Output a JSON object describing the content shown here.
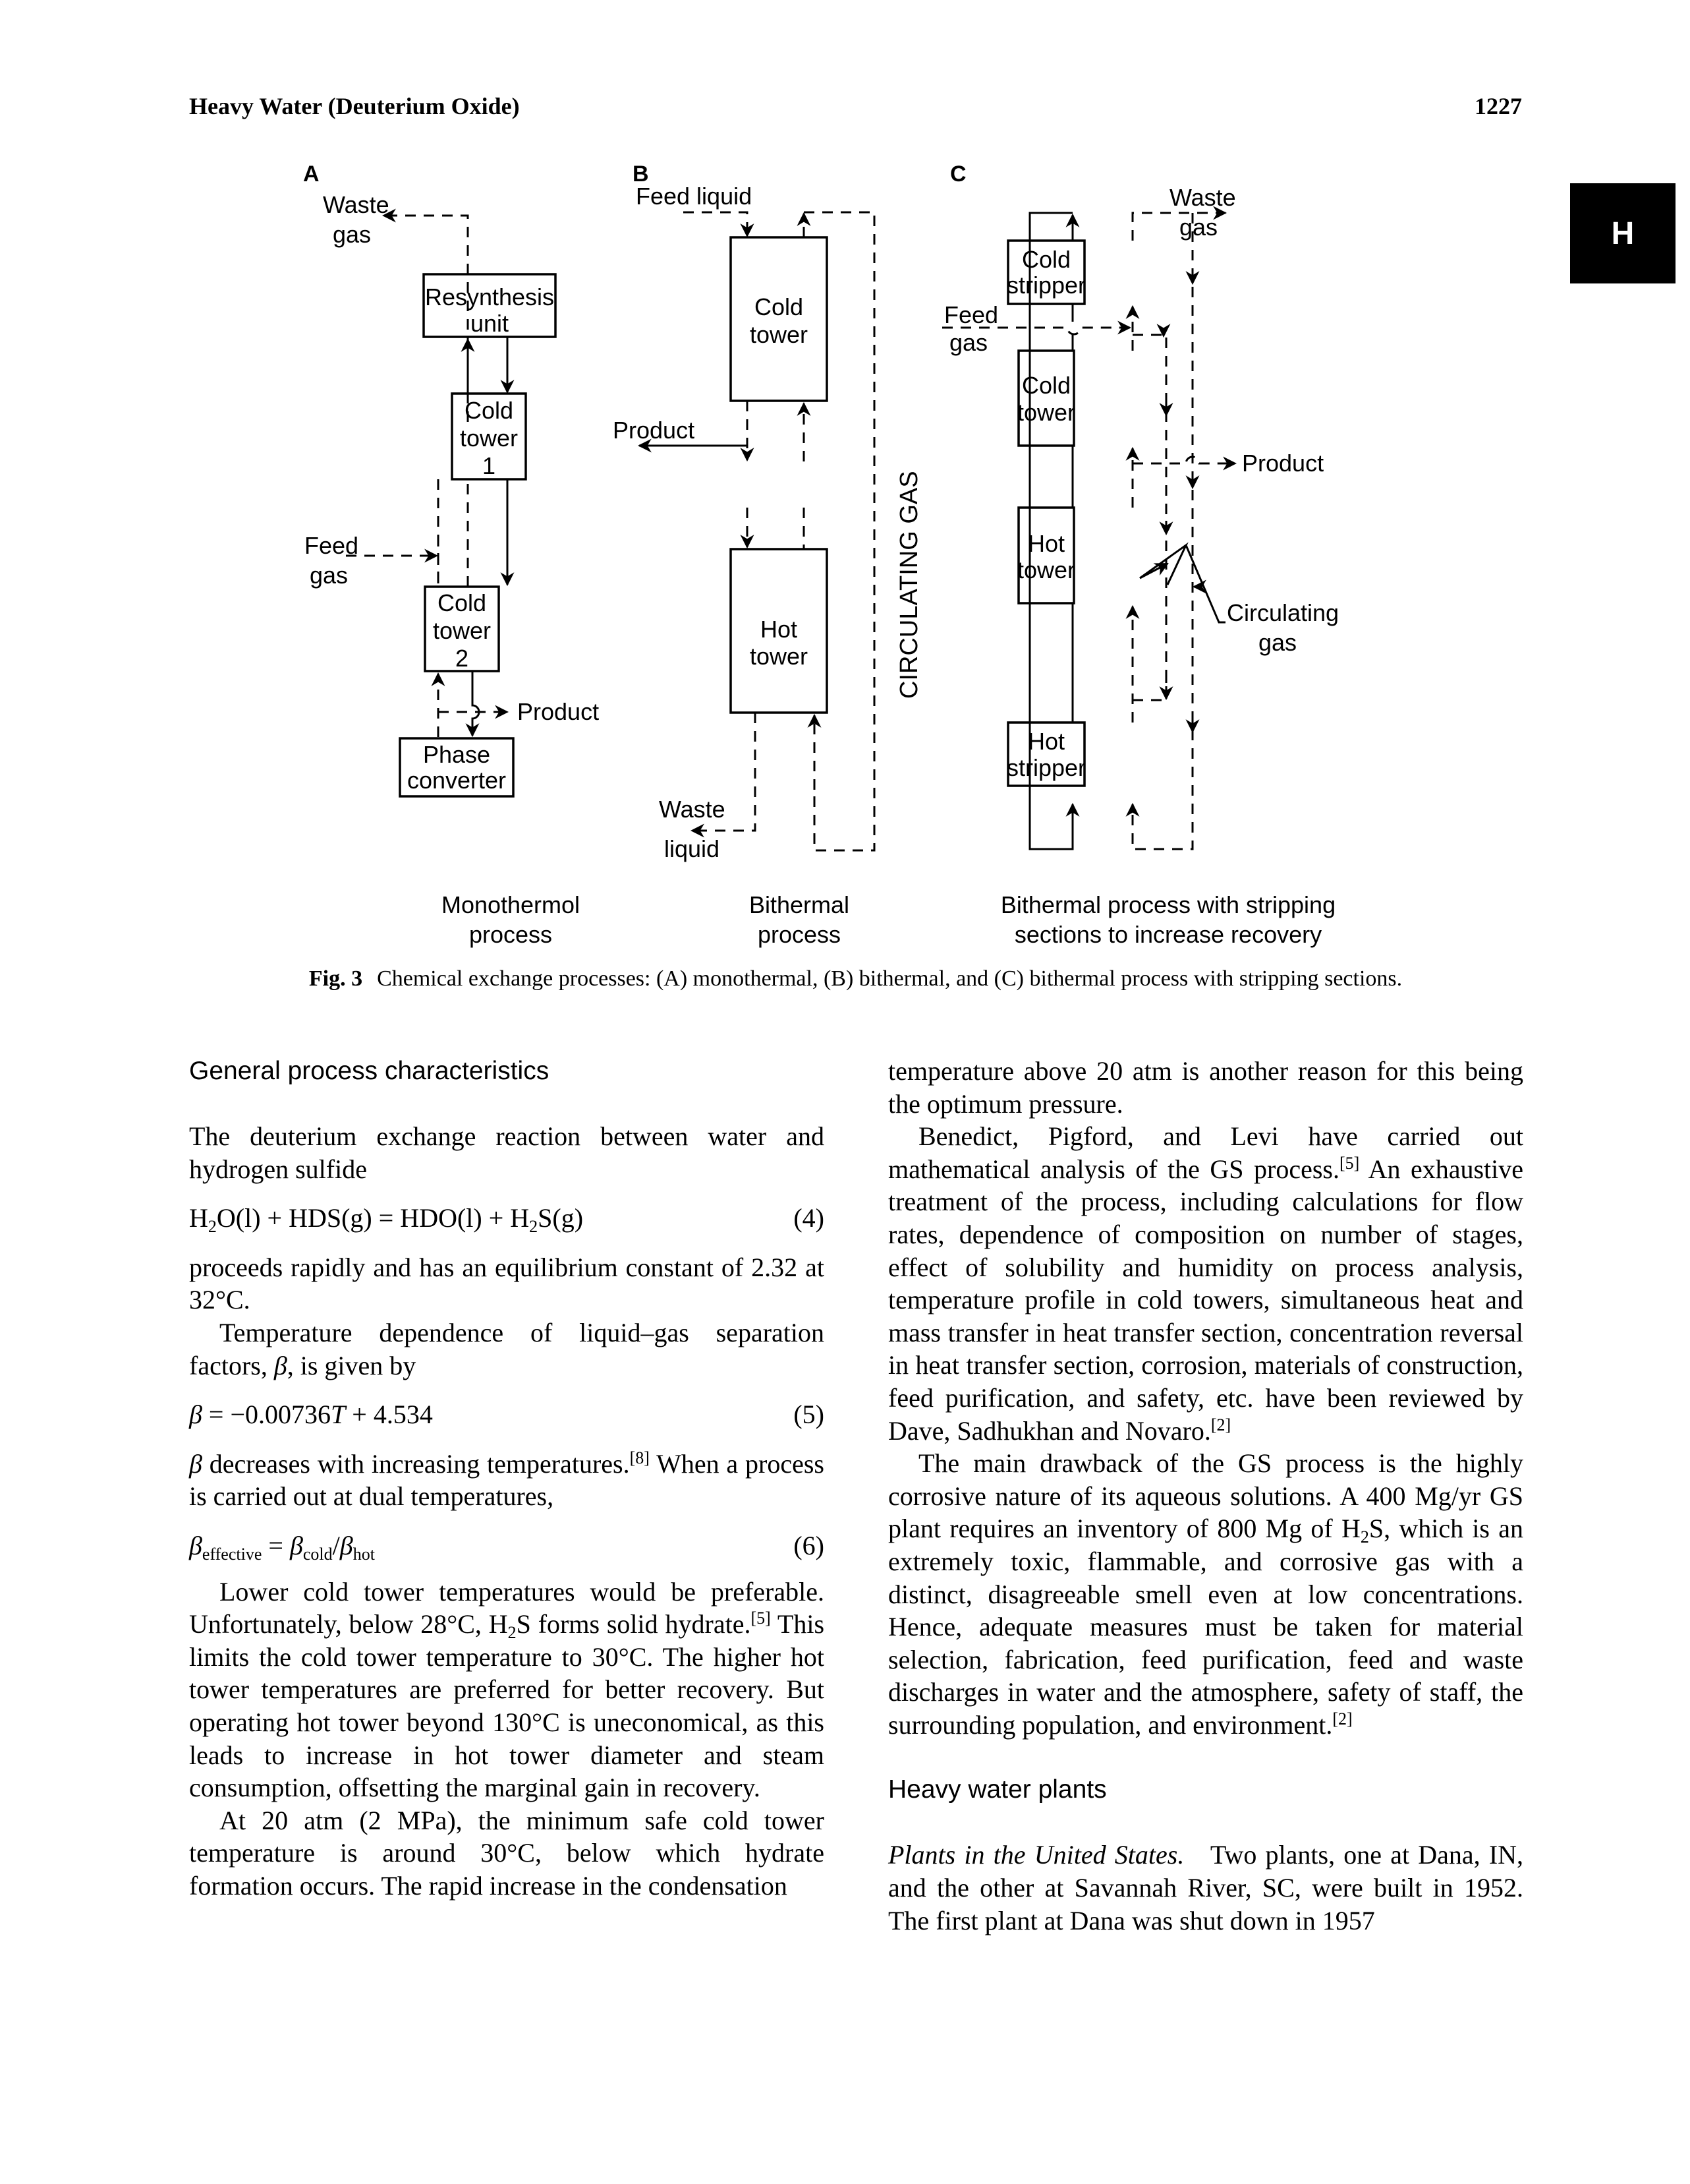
{
  "running_head": {
    "title": "Heavy Water (Deuterium Oxide)",
    "page_number": "1227"
  },
  "thumb_tab": {
    "letter": "H"
  },
  "figure": {
    "panel_a": {
      "letter": "A",
      "waste_gas": [
        "Waste",
        "gas"
      ],
      "feed_gas": [
        "Feed",
        "gas"
      ],
      "resynthesis_unit": [
        "Resynthesis",
        "unit"
      ],
      "cold_tower_1": [
        "Cold",
        "tower",
        "1"
      ],
      "cold_tower_2": [
        "Cold",
        "tower",
        "2"
      ],
      "product": "Product",
      "phase_converter": [
        "Phase",
        "converter"
      ],
      "subtitle": [
        "Monothermol",
        "process"
      ]
    },
    "panel_b": {
      "letter": "B",
      "feed_liquid": "Feed liquid",
      "cold_tower": [
        "Cold",
        "tower"
      ],
      "hot_tower": [
        "Hot",
        "tower"
      ],
      "product": "Product",
      "waste_liquid": [
        "Waste",
        "liquid"
      ],
      "circulating_gas": "CIRCULATING GAS",
      "subtitle": [
        "Bithermal",
        "process"
      ]
    },
    "panel_c": {
      "letter": "C",
      "waste_gas": [
        "Waste",
        "gas"
      ],
      "feed_gas": [
        "Feed",
        "gas"
      ],
      "cold_stripper": [
        "Cold",
        "stripper"
      ],
      "cold_tower": [
        "Cold",
        "tower"
      ],
      "hot_tower": [
        "Hot",
        "tower"
      ],
      "hot_stripper": [
        "Hot",
        "stripper"
      ],
      "product": "Product",
      "circulating_gas": [
        "Circulating",
        "gas"
      ],
      "subtitle": [
        "Bithermal process with stripping",
        "sections to increase recovery"
      ]
    },
    "caption_label": "Fig. 3",
    "caption_text": "Chemical exchange processes: (A) monothermal, (B) bithermal, and (C) bithermal process with stripping sections."
  },
  "left_column": {
    "heading": "General process characteristics",
    "p1": "The deuterium exchange reaction between water and hydrogen sulfide",
    "eq4": {
      "lhs_a": "H",
      "lhs_a_sub": "2",
      "lhs_b": "O(l) + HDS(g) = HDO(l) + H",
      "rhs_sub": "2",
      "rhs_b": "S(g)",
      "number": "(4)"
    },
    "p2": "proceeds rapidly and has an equilibrium constant of 2.32 at 32°C.",
    "p3_a": "Temperature dependence of liquid–gas separation factors, ",
    "p3_beta": "β",
    "p3_b": ", is given by",
    "eq5": {
      "beta": "β",
      "text_a": " = −0.00736",
      "T": "T",
      "text_b": " + 4.534",
      "number": "(5)"
    },
    "p4_beta": "β",
    "p4_a": " decreases with increasing temperatures.",
    "p4_ref": "[8]",
    "p4_b": " When a process is carried out at dual temperatures,",
    "eq6": {
      "beta": "β",
      "sub_eff": "effective",
      "eq": " = ",
      "sub_cold": "cold",
      "slash": "/",
      "sub_hot": "hot",
      "number": "(6)"
    },
    "p5_a": "Lower cold tower temperatures would be preferable. Unfortunately, below 28°C, H",
    "p5_sub": "2",
    "p5_b": "S forms solid hydrate.",
    "p5_ref": "[5]",
    "p5_c": " This limits the cold tower temperature to 30°C. The higher hot tower temperatures are preferred for better recovery. But operating hot tower beyond 130°C is uneconomical, as this leads to increase in hot tower diameter and steam consumption, offsetting the marginal gain in recovery.",
    "p6": "At 20 atm (2 MPa), the minimum safe cold tower temperature is around 30°C, below which hydrate formation occurs. The rapid increase in the condensation"
  },
  "right_column": {
    "p1": "temperature above 20 atm is another reason for this being the optimum pressure.",
    "p2_a": "Benedict, Pigford, and Levi have carried out mathematical analysis of the GS process.",
    "p2_ref1": "[5]",
    "p2_b": " An exhaustive treatment of the process, including calculations for flow rates, dependence of composition on number of stages, effect of solubility and humidity on process analysis, temperature profile in cold towers, simultaneous heat and mass transfer in heat transfer section, concentration reversal in heat transfer section, corrosion, materials of construction, feed purification, and safety, etc. have been reviewed by Dave, Sadhukhan and Novaro.",
    "p2_ref2": "[2]",
    "p3_a": "The main drawback of the GS process is the highly corrosive nature of its aqueous solutions. A 400 Mg/yr GS plant requires an inventory of 800 Mg of H",
    "p3_sub": "2",
    "p3_b": "S, which is an extremely toxic, flammable, and corrosive gas with a distinct, disagreeable smell even at low concentrations. Hence, adequate measures must be taken for material selection, fabrication, feed purification, feed and waste discharges in water and the atmosphere, safety of staff, the surrounding population, and environment.",
    "p3_ref": "[2]",
    "heading": "Heavy water plants",
    "p4_italic": "Plants in the United States.",
    "p4_text": "Two plants, one at Dana, IN, and the other at Savannah River, SC, were built in 1952. The first plant at Dana was shut down in 1957"
  }
}
